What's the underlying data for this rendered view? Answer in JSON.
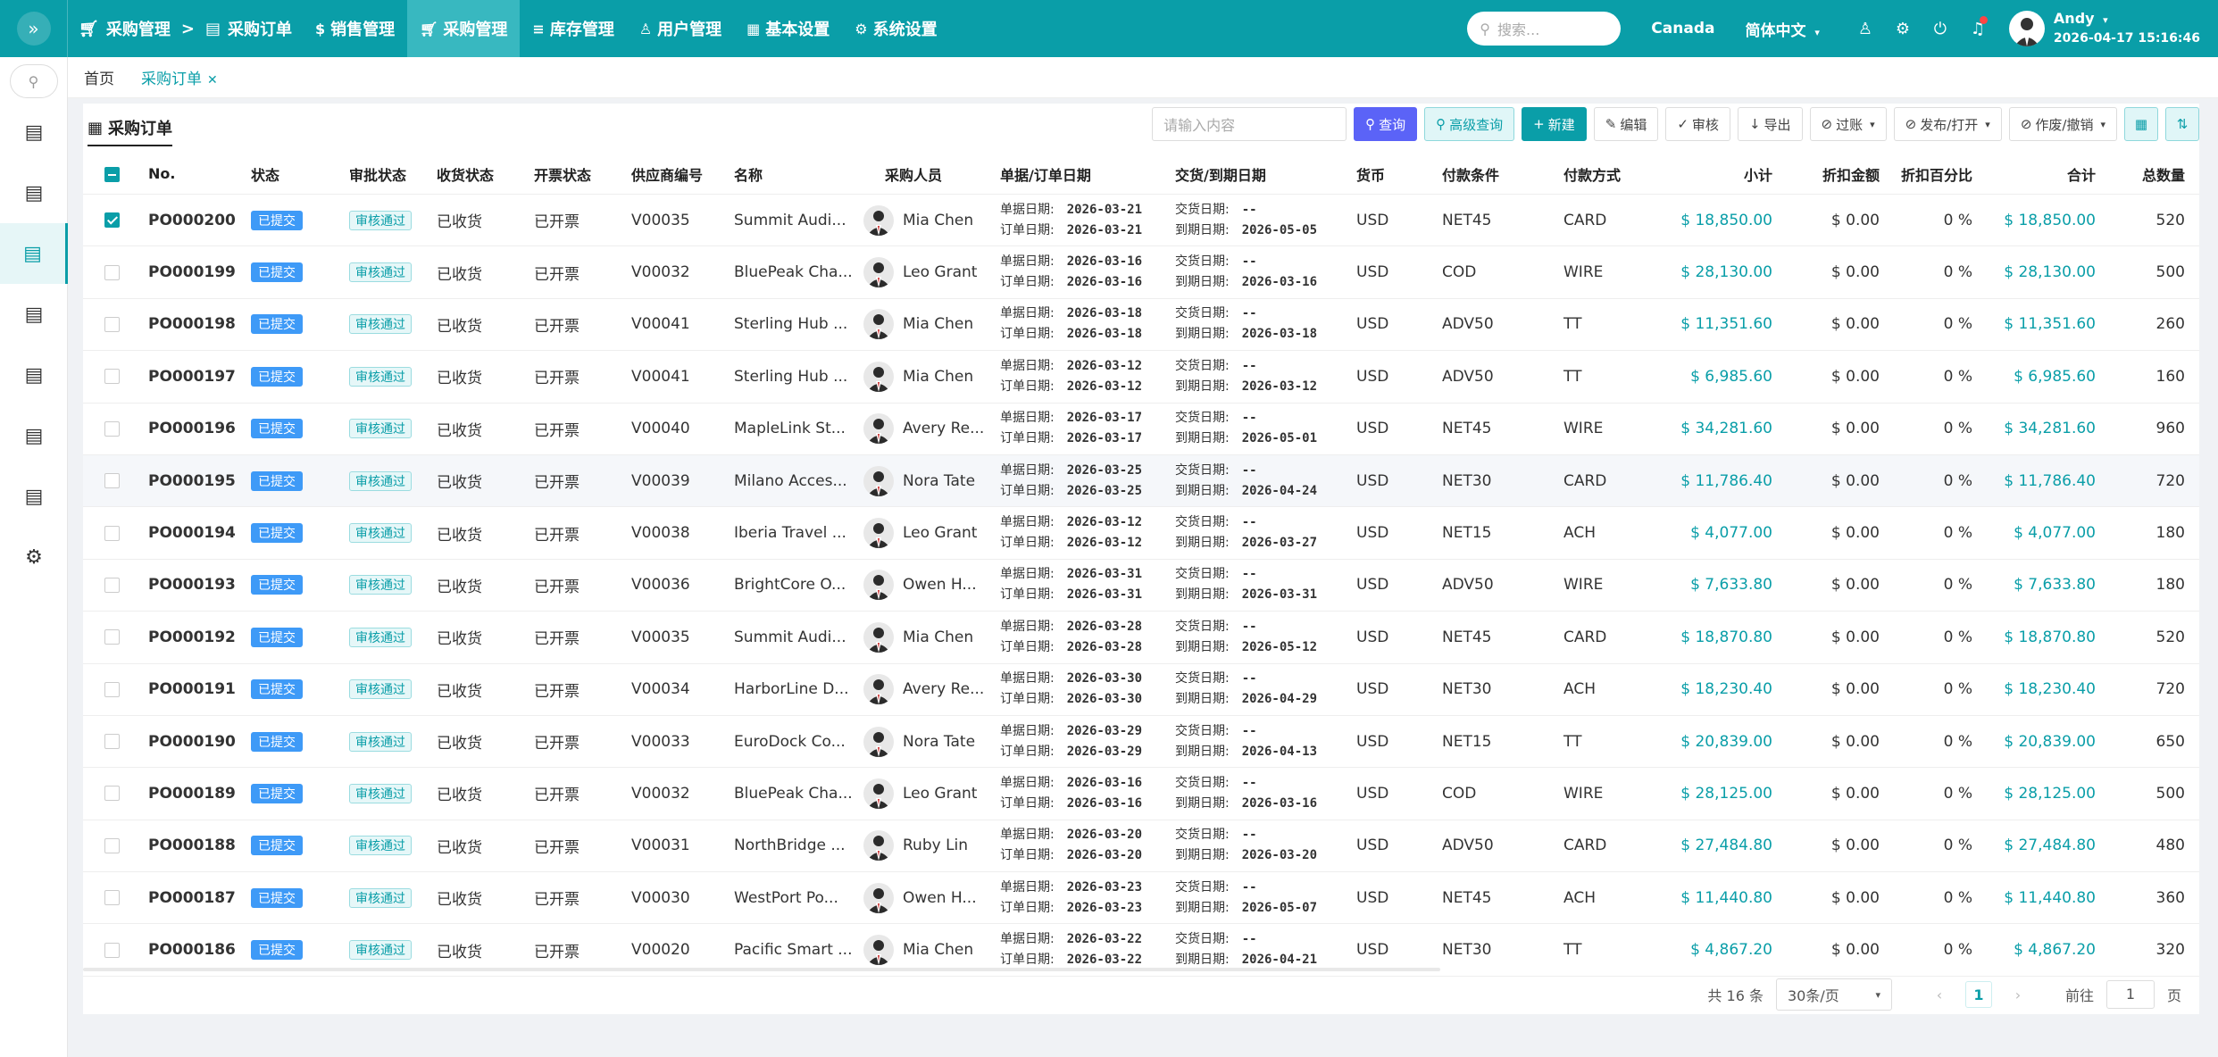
{
  "topbar": {
    "breadcrumb": [
      "采购管理",
      "采购订单"
    ],
    "breadcrumb_sep": ">",
    "nav": [
      {
        "label": "销售管理",
        "icon": "dollar-icon"
      },
      {
        "label": "采购管理",
        "icon": "cart-icon",
        "active": true
      },
      {
        "label": "库存管理",
        "icon": "database-icon"
      },
      {
        "label": "用户管理",
        "icon": "user-icon"
      },
      {
        "label": "基本设置",
        "icon": "grid-icon"
      },
      {
        "label": "系统设置",
        "icon": "gear-icon"
      }
    ],
    "search_placeholder": "搜索...",
    "region": "Canada",
    "language": "简体中文",
    "user_name": "Andy",
    "datetime": "2026-04-17 15:16:46"
  },
  "tabs": [
    {
      "label": "首页",
      "active": false
    },
    {
      "label": "采购订单",
      "active": true
    }
  ],
  "panel": {
    "title": "采购订单",
    "search_placeholder": "请输入内容",
    "buttons": {
      "query": "查询",
      "advanced": "高级查询",
      "new": "新建",
      "edit": "编辑",
      "audit": "审核",
      "export": "导出",
      "post": "过账",
      "publish": "发布/打开",
      "void": "作废/撤销"
    }
  },
  "table": {
    "headers": {
      "no": "No.",
      "status": "状态",
      "approval": "审批状态",
      "receipt": "收货状态",
      "invoice": "开票状态",
      "vendor": "供应商编号",
      "name": "名称",
      "buyer": "采购人员",
      "doc_date": "单据/订单日期",
      "due_date": "交货/到期日期",
      "currency": "货币",
      "terms": "付款条件",
      "method": "付款方式",
      "subtotal": "小计",
      "discount": "折扣金额",
      "discount_pct": "折扣百分比",
      "total": "合计",
      "qty": "总数量"
    },
    "labels": {
      "doc": "单据日期:",
      "order": "订单日期:",
      "delivery": "交货日期:",
      "due": "到期日期:"
    },
    "rows": [
      {
        "no": "PO000200",
        "status": "已提交",
        "approval": "审核通过",
        "receipt": "已收货",
        "invoice": "已开票",
        "vendor": "V00035",
        "name": "Summit Audi...",
        "buyer": "Mia Chen",
        "doc": "2026-03-21",
        "order": "2026-03-21",
        "delivery": "--",
        "due": "2026-05-05",
        "currency": "USD",
        "terms": "NET45",
        "method": "CARD",
        "subtotal": "$ 18,850.00",
        "discount": "$ 0.00",
        "pct": "0 %",
        "total": "$ 18,850.00",
        "qty": "520",
        "checked": true
      },
      {
        "no": "PO000199",
        "status": "已提交",
        "approval": "审核通过",
        "receipt": "已收货",
        "invoice": "已开票",
        "vendor": "V00032",
        "name": "BluePeak Cha...",
        "buyer": "Leo Grant",
        "doc": "2026-03-16",
        "order": "2026-03-16",
        "delivery": "--",
        "due": "2026-03-16",
        "currency": "USD",
        "terms": "COD",
        "method": "WIRE",
        "subtotal": "$ 28,130.00",
        "discount": "$ 0.00",
        "pct": "0 %",
        "total": "$ 28,130.00",
        "qty": "500"
      },
      {
        "no": "PO000198",
        "status": "已提交",
        "approval": "审核通过",
        "receipt": "已收货",
        "invoice": "已开票",
        "vendor": "V00041",
        "name": "Sterling Hub ...",
        "buyer": "Mia Chen",
        "doc": "2026-03-18",
        "order": "2026-03-18",
        "delivery": "--",
        "due": "2026-03-18",
        "currency": "USD",
        "terms": "ADV50",
        "method": "TT",
        "subtotal": "$ 11,351.60",
        "discount": "$ 0.00",
        "pct": "0 %",
        "total": "$ 11,351.60",
        "qty": "260"
      },
      {
        "no": "PO000197",
        "status": "已提交",
        "approval": "审核通过",
        "receipt": "已收货",
        "invoice": "已开票",
        "vendor": "V00041",
        "name": "Sterling Hub ...",
        "buyer": "Mia Chen",
        "doc": "2026-03-12",
        "order": "2026-03-12",
        "delivery": "--",
        "due": "2026-03-12",
        "currency": "USD",
        "terms": "ADV50",
        "method": "TT",
        "subtotal": "$ 6,985.60",
        "discount": "$ 0.00",
        "pct": "0 %",
        "total": "$ 6,985.60",
        "qty": "160"
      },
      {
        "no": "PO000196",
        "status": "已提交",
        "approval": "审核通过",
        "receipt": "已收货",
        "invoice": "已开票",
        "vendor": "V00040",
        "name": "MapleLink St...",
        "buyer": "Avery Re...",
        "doc": "2026-03-17",
        "order": "2026-03-17",
        "delivery": "--",
        "due": "2026-05-01",
        "currency": "USD",
        "terms": "NET45",
        "method": "WIRE",
        "subtotal": "$ 34,281.60",
        "discount": "$ 0.00",
        "pct": "0 %",
        "total": "$ 34,281.60",
        "qty": "960"
      },
      {
        "no": "PO000195",
        "status": "已提交",
        "approval": "审核通过",
        "receipt": "已收货",
        "invoice": "已开票",
        "vendor": "V00039",
        "name": "Milano Acces...",
        "buyer": "Nora Tate",
        "doc": "2026-03-25",
        "order": "2026-03-25",
        "delivery": "--",
        "due": "2026-04-24",
        "currency": "USD",
        "terms": "NET30",
        "method": "CARD",
        "subtotal": "$ 11,786.40",
        "discount": "$ 0.00",
        "pct": "0 %",
        "total": "$ 11,786.40",
        "qty": "720",
        "highlight": true
      },
      {
        "no": "PO000194",
        "status": "已提交",
        "approval": "审核通过",
        "receipt": "已收货",
        "invoice": "已开票",
        "vendor": "V00038",
        "name": "Iberia Travel ...",
        "buyer": "Leo Grant",
        "doc": "2026-03-12",
        "order": "2026-03-12",
        "delivery": "--",
        "due": "2026-03-27",
        "currency": "USD",
        "terms": "NET15",
        "method": "ACH",
        "subtotal": "$ 4,077.00",
        "discount": "$ 0.00",
        "pct": "0 %",
        "total": "$ 4,077.00",
        "qty": "180"
      },
      {
        "no": "PO000193",
        "status": "已提交",
        "approval": "审核通过",
        "receipt": "已收货",
        "invoice": "已开票",
        "vendor": "V00036",
        "name": "BrightCore O...",
        "buyer": "Owen H...",
        "doc": "2026-03-31",
        "order": "2026-03-31",
        "delivery": "--",
        "due": "2026-03-31",
        "currency": "USD",
        "terms": "ADV50",
        "method": "WIRE",
        "subtotal": "$ 7,633.80",
        "discount": "$ 0.00",
        "pct": "0 %",
        "total": "$ 7,633.80",
        "qty": "180"
      },
      {
        "no": "PO000192",
        "status": "已提交",
        "approval": "审核通过",
        "receipt": "已收货",
        "invoice": "已开票",
        "vendor": "V00035",
        "name": "Summit Audi...",
        "buyer": "Mia Chen",
        "doc": "2026-03-28",
        "order": "2026-03-28",
        "delivery": "--",
        "due": "2026-05-12",
        "currency": "USD",
        "terms": "NET45",
        "method": "CARD",
        "subtotal": "$ 18,870.80",
        "discount": "$ 0.00",
        "pct": "0 %",
        "total": "$ 18,870.80",
        "qty": "520"
      },
      {
        "no": "PO000191",
        "status": "已提交",
        "approval": "审核通过",
        "receipt": "已收货",
        "invoice": "已开票",
        "vendor": "V00034",
        "name": "HarborLine D...",
        "buyer": "Avery Re...",
        "doc": "2026-03-30",
        "order": "2026-03-30",
        "delivery": "--",
        "due": "2026-04-29",
        "currency": "USD",
        "terms": "NET30",
        "method": "ACH",
        "subtotal": "$ 18,230.40",
        "discount": "$ 0.00",
        "pct": "0 %",
        "total": "$ 18,230.40",
        "qty": "720"
      },
      {
        "no": "PO000190",
        "status": "已提交",
        "approval": "审核通过",
        "receipt": "已收货",
        "invoice": "已开票",
        "vendor": "V00033",
        "name": "EuroDock Co...",
        "buyer": "Nora Tate",
        "doc": "2026-03-29",
        "order": "2026-03-29",
        "delivery": "--",
        "due": "2026-04-13",
        "currency": "USD",
        "terms": "NET15",
        "method": "TT",
        "subtotal": "$ 20,839.00",
        "discount": "$ 0.00",
        "pct": "0 %",
        "total": "$ 20,839.00",
        "qty": "650"
      },
      {
        "no": "PO000189",
        "status": "已提交",
        "approval": "审核通过",
        "receipt": "已收货",
        "invoice": "已开票",
        "vendor": "V00032",
        "name": "BluePeak Cha...",
        "buyer": "Leo Grant",
        "doc": "2026-03-16",
        "order": "2026-03-16",
        "delivery": "--",
        "due": "2026-03-16",
        "currency": "USD",
        "terms": "COD",
        "method": "WIRE",
        "subtotal": "$ 28,125.00",
        "discount": "$ 0.00",
        "pct": "0 %",
        "total": "$ 28,125.00",
        "qty": "500"
      },
      {
        "no": "PO000188",
        "status": "已提交",
        "approval": "审核通过",
        "receipt": "已收货",
        "invoice": "已开票",
        "vendor": "V00031",
        "name": "NorthBridge ...",
        "buyer": "Ruby Lin",
        "doc": "2026-03-20",
        "order": "2026-03-20",
        "delivery": "--",
        "due": "2026-03-20",
        "currency": "USD",
        "terms": "ADV50",
        "method": "CARD",
        "subtotal": "$ 27,484.80",
        "discount": "$ 0.00",
        "pct": "0 %",
        "total": "$ 27,484.80",
        "qty": "480"
      },
      {
        "no": "PO000187",
        "status": "已提交",
        "approval": "审核通过",
        "receipt": "已收货",
        "invoice": "已开票",
        "vendor": "V00030",
        "name": "WestPort Po...",
        "buyer": "Owen H...",
        "doc": "2026-03-23",
        "order": "2026-03-23",
        "delivery": "--",
        "due": "2026-05-07",
        "currency": "USD",
        "terms": "NET45",
        "method": "ACH",
        "subtotal": "$ 11,440.80",
        "discount": "$ 0.00",
        "pct": "0 %",
        "total": "$ 11,440.80",
        "qty": "360"
      },
      {
        "no": "PO000186",
        "status": "已提交",
        "approval": "审核通过",
        "receipt": "已收货",
        "invoice": "已开票",
        "vendor": "V00020",
        "name": "Pacific Smart ...",
        "buyer": "Mia Chen",
        "doc": "2026-03-22",
        "order": "2026-03-22",
        "delivery": "--",
        "due": "2026-04-21",
        "currency": "USD",
        "terms": "NET30",
        "method": "TT",
        "subtotal": "$ 4,867.20",
        "discount": "$ 0.00",
        "pct": "0 %",
        "total": "$ 4,867.20",
        "qty": "320"
      }
    ]
  },
  "pagination": {
    "total": "共 16 条",
    "page_size": "30条/页",
    "current": "1",
    "goto_label": "前往",
    "goto_value": "1",
    "page_suffix": "页"
  },
  "colors": {
    "primary": "#0a9ea8",
    "query": "#5b63f7",
    "tag_submitted": "#3e9af7"
  }
}
